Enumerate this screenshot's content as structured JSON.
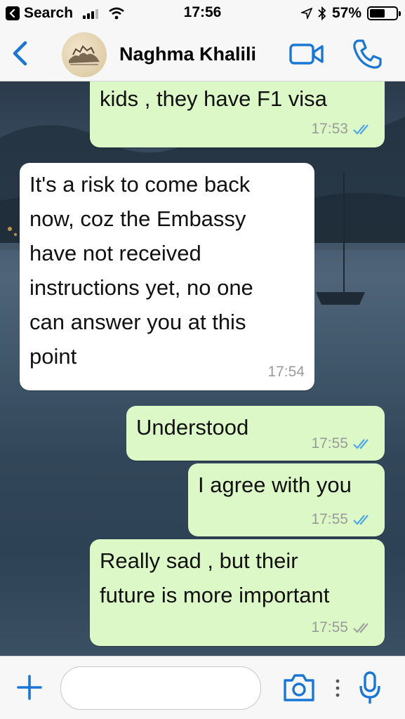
{
  "status_bar": {
    "back_app": "Search",
    "time": "17:56",
    "battery": "57%",
    "battery_level": 0.57
  },
  "header": {
    "contact_name": "Naghma Khalili"
  },
  "messages": [
    {
      "direction": "out",
      "text": "kids , they have F1 visa",
      "time": "17:53",
      "status": "read"
    },
    {
      "direction": "in",
      "text": "It's a risk to come back\nnow, coz the Embassy\nhave not received\ninstructions yet, no one\ncan answer you at this\npoint",
      "time": "17:54"
    },
    {
      "direction": "out",
      "text": "Understood",
      "time": "17:55",
      "status": "read"
    },
    {
      "direction": "out",
      "text": "I agree with you",
      "time": "17:55",
      "status": "read"
    },
    {
      "direction": "out",
      "text": "Really sad , but their\nfuture is more important",
      "time": "17:55",
      "status": "delivered"
    }
  ],
  "composer": {
    "placeholder": ""
  },
  "colors": {
    "accent": "#1877d6",
    "outgoing_bubble": "#dcf8c6",
    "incoming_bubble": "#ffffff",
    "read_ticks": "#4fa7e6",
    "delivered_ticks": "#a0a0a0"
  },
  "icons": [
    "back-chevron-icon",
    "video-call-icon",
    "phone-icon",
    "plus-icon",
    "camera-icon",
    "more-dots-icon",
    "microphone-icon",
    "wifi-icon",
    "signal-icon",
    "location-arrow-icon",
    "bluetooth-icon",
    "battery-icon"
  ]
}
